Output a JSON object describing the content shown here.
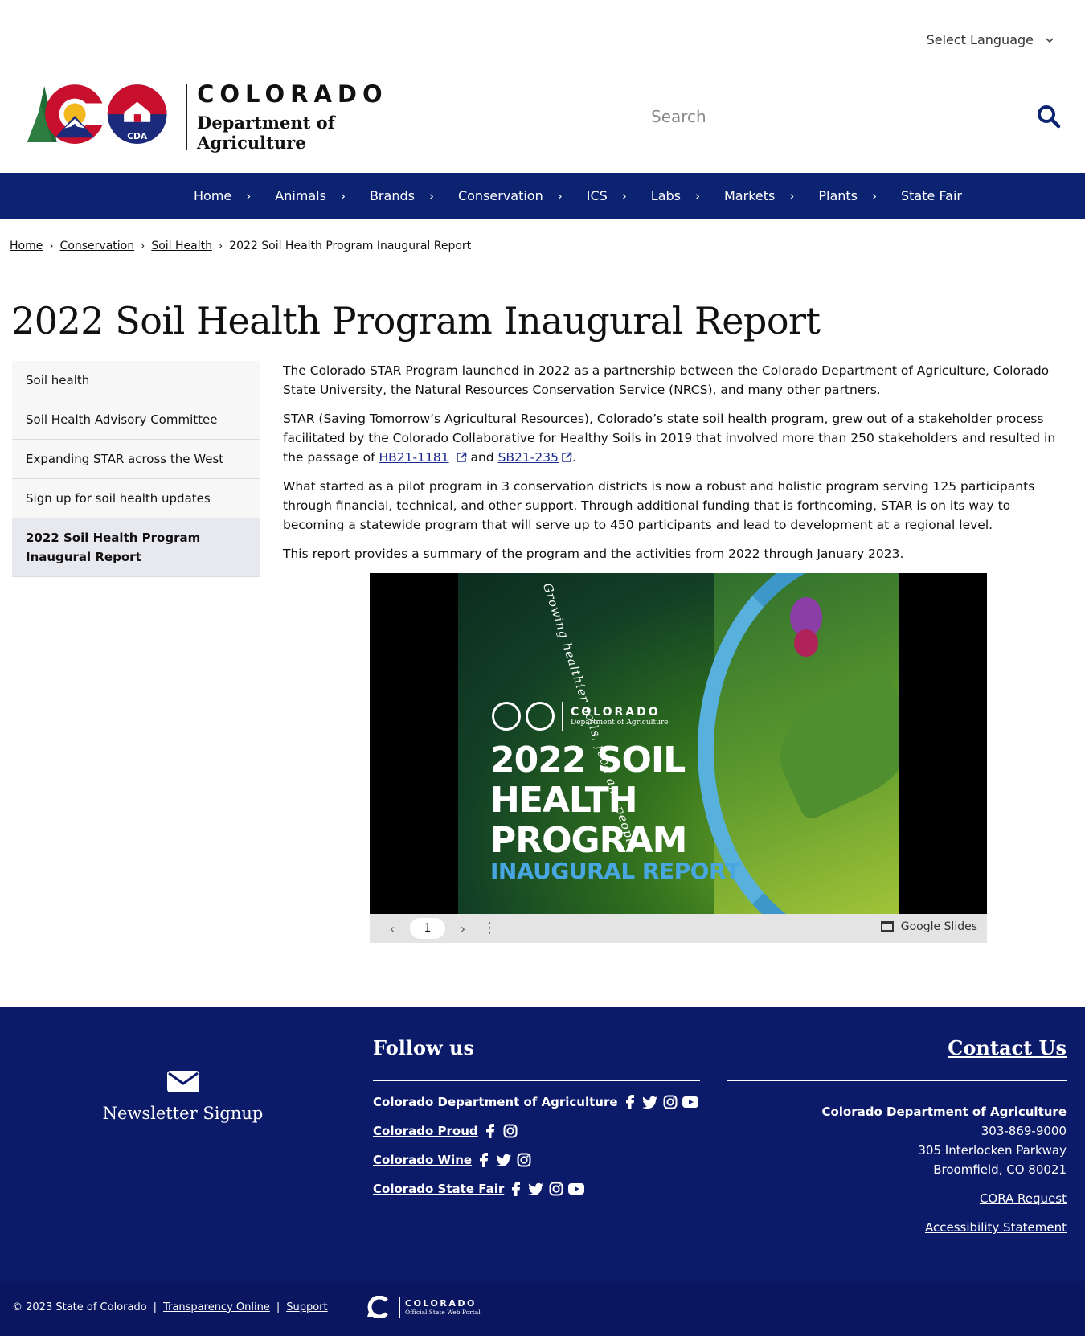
{
  "language": {
    "label": "Select Language"
  },
  "header": {
    "brand_big": "COLORADO",
    "brand_small": "Department of Agriculture",
    "logo_text": "CDA",
    "search_placeholder": "Search"
  },
  "nav": {
    "items": [
      "Home",
      "Animals",
      "Brands",
      "Conservation",
      "ICS",
      "Labs",
      "Markets",
      "Plants",
      "State Fair"
    ]
  },
  "breadcrumb": {
    "items": [
      "Home",
      "Conservation",
      "Soil Health"
    ],
    "current": "2022 Soil Health Program Inaugural Report"
  },
  "page_title": "2022 Soil Health Program Inaugural Report",
  "sidebar": {
    "items": [
      "Soil health",
      "Soil Health Advisory Committee",
      "Expanding STAR across the West",
      "Sign up for soil health updates",
      "2022 Soil Health Program Inaugural Report"
    ],
    "active_index": 4
  },
  "content": {
    "p1": "The Colorado STAR Program launched in 2022 as a partnership between the Colorado Department of Agriculture, Colorado State University, the Natural Resources Conservation Service (NRCS), and many other partners.",
    "p2_pre": "STAR (Saving Tomorrow’s Agricultural Resources), Colorado’s state soil health program, grew out of a stakeholder process facilitated by the Colorado Collaborative for Healthy Soils in 2019 that involved more than 250 stakeholders and resulted in the passage of ",
    "link1": "HB21-1181",
    "p2_mid": " and ",
    "link2": "SB21-235",
    "p2_end": ".",
    "p3": "What started as a pilot program in 3 conservation districts is now a robust and holistic program serving 125 participants through financial, technical, and other support. Through additional funding that is forthcoming, STAR is on its way to becoming a statewide program that will serve up to 450 participants and lead to development at a regional level.",
    "p4": "This report provides a summary of the program and the activities from 2022 through January 2023."
  },
  "slides": {
    "brand_big": "COLORADO",
    "brand_small": "Department of Agriculture",
    "headline_1": "2022 SOIL",
    "headline_2": "HEALTH",
    "headline_3": "PROGRAM",
    "subtitle": "INAUGURAL REPORT",
    "script": "Growing healthier soils, food and people",
    "page": "1",
    "provider": "Google Slides"
  },
  "footer": {
    "newsletter": "Newsletter Signup",
    "follow_title": "Follow us",
    "social_rows": [
      {
        "name": "Colorado Department of Agriculture",
        "icons": [
          "facebook-icon",
          "twitter-icon",
          "instagram-icon",
          "youtube-icon"
        ]
      },
      {
        "name": "Colorado Proud",
        "icons": [
          "facebook-icon",
          "instagram-icon"
        ]
      },
      {
        "name": "Colorado Wine",
        "icons": [
          "facebook-icon",
          "twitter-icon",
          "instagram-icon"
        ]
      },
      {
        "name": "Colorado State Fair",
        "icons": [
          "facebook-icon",
          "twitter-icon",
          "instagram-icon",
          "youtube-icon"
        ]
      }
    ],
    "contact_title": "Contact Us",
    "org": "Colorado Department of Agriculture",
    "phone": "303-869-9000",
    "address1": "305 Interlocken Parkway",
    "address2": "Broomfield, CO 80021",
    "cora": "CORA Request",
    "accessibility": "Accessibility Statement"
  },
  "bottom": {
    "copyright": "© 2023 State of Colorado",
    "sep": "|",
    "transparency": "Transparency Online",
    "support": "Support",
    "portal_big": "COLORADO",
    "portal_small": "Official State Web Portal"
  },
  "colors": {
    "nav_bg": "#0c2372",
    "footer_bg": "#0c1a6a",
    "link": "#1a2a8a"
  }
}
